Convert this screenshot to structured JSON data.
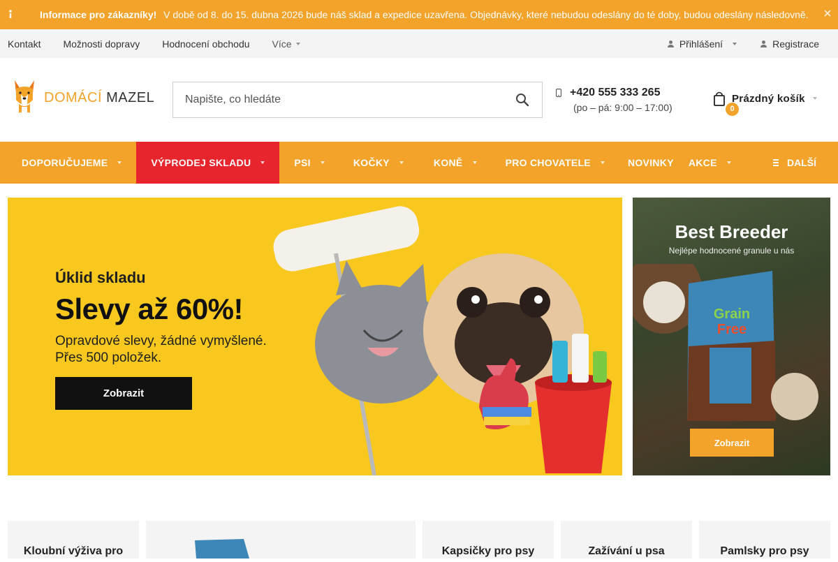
{
  "infobar": {
    "title": "Informace pro zákazníky!",
    "message": "V době od 8. do 15. dubna 2026 bude náš sklad a expedice uzavřena. Objednávky, které nebudou odeslány do té doby, budou odeslány následovně.",
    "icon": "info-icon",
    "close_icon": "close-icon"
  },
  "toplinks": {
    "left": [
      "Kontakt",
      "Možnosti dopravy",
      "Hodnocení obchodu"
    ],
    "more_label": "Více",
    "login_label": "Přihlášení",
    "register_label": "Registrace"
  },
  "header": {
    "logo": {
      "part1": "DOMÁCÍ",
      "part2": "MAZEL"
    },
    "search_placeholder": "Napište, co hledáte",
    "phone": "+420 555 333 265",
    "phone_hours": "(po – pá: 9:00 – 17:00)",
    "cart_label": "Prázdný košík",
    "cart_count": "0"
  },
  "nav": {
    "items": [
      {
        "label": "DOPORUČUJEME"
      },
      {
        "label": "VÝPRODEJ SKLADU"
      },
      {
        "label": "PSI"
      },
      {
        "label": "KOČKY"
      },
      {
        "label": "KONĚ"
      },
      {
        "label": "PRO CHOVATELE"
      },
      {
        "label": "NOVINKY"
      },
      {
        "label": "AKCE"
      }
    ],
    "more_label": "DALŠÍ"
  },
  "banner_main": {
    "line1": "Úklid skladu",
    "line2": "Slevy až 60%!",
    "line3": "Opravdové slevy, žádné vymyšlené.",
    "line4": "Přes 500 položek.",
    "button": "Zobrazit"
  },
  "banner_side": {
    "title": "Best Breeder",
    "subtitle": "Nejlépe hodnocené granule u nás",
    "button": "Zobrazit"
  },
  "cards": [
    "Kloubní výživa pro",
    "Kapsičky pro psy",
    "Zažívání u psa",
    "Pamlsky pro psy"
  ],
  "colors": {
    "accent": "#f3a22a",
    "active_nav": "#e8242c",
    "banner_yellow": "#f9c81e"
  }
}
